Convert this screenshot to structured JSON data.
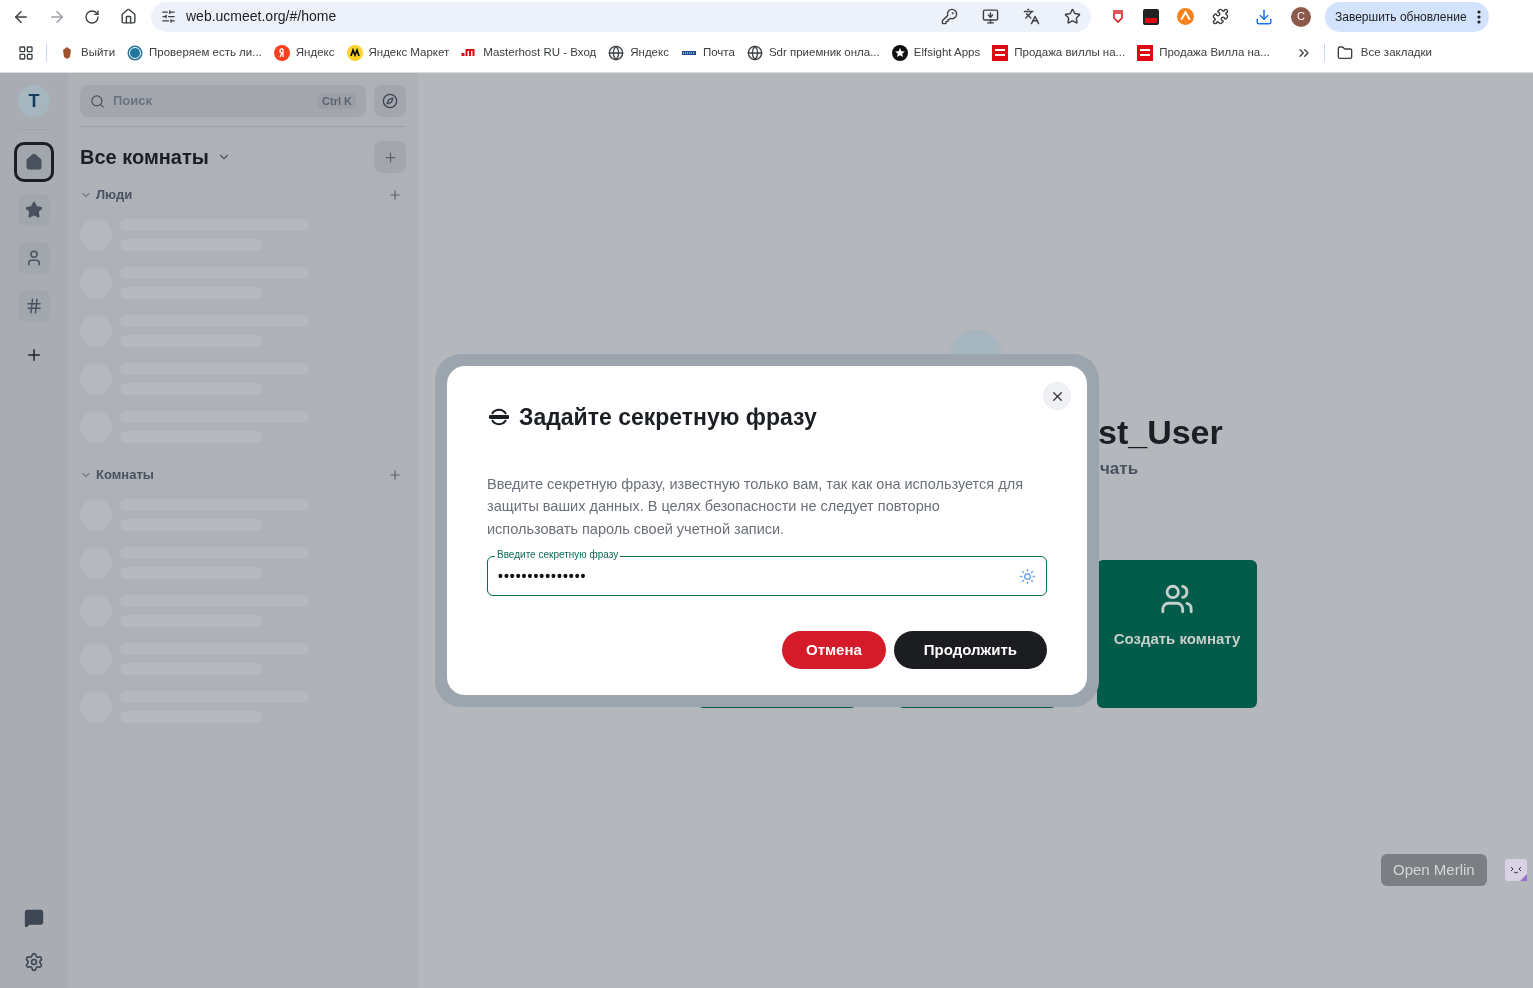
{
  "browser": {
    "url": "web.ucmeet.org/#/home",
    "update_button": "Завершить обновление",
    "profile_initial": "C",
    "bookmarks": [
      {
        "kind": "emblem",
        "label": "Выйти"
      },
      {
        "kind": "wordpress",
        "label": "Проверяем есть ли..."
      },
      {
        "kind": "yandex",
        "label": "Яндекс"
      },
      {
        "kind": "market",
        "label": "Яндекс Маркет"
      },
      {
        "kind": "masterhost",
        "label": "Masterhost RU - Вход"
      },
      {
        "kind": "globe",
        "label": "Яндекс"
      },
      {
        "kind": "mail",
        "label": "Почта"
      },
      {
        "kind": "globe",
        "label": "Sdr приемник онла..."
      },
      {
        "kind": "star",
        "label": "Elfsight Apps"
      },
      {
        "kind": "news",
        "label": "Продажа виллы на..."
      },
      {
        "kind": "news",
        "label": "Продажа Вилла на..."
      }
    ],
    "all_bookmarks": "Все закладки"
  },
  "rail": {
    "avatar": "T",
    "items": [
      {
        "kind": "home",
        "selected": true
      },
      {
        "kind": "star",
        "selected": false
      },
      {
        "kind": "person",
        "selected": false
      },
      {
        "kind": "hash",
        "selected": false
      }
    ]
  },
  "sidebar": {
    "search_placeholder": "Поиск",
    "shortcut": "Ctrl K",
    "title": "Все комнаты",
    "sections": [
      {
        "label": "Люди",
        "expanded": true
      },
      {
        "label": "Комнаты",
        "expanded": true
      }
    ]
  },
  "main": {
    "name": "st_User",
    "subtitle": "чать",
    "card": "Создать комнату"
  },
  "dialog": {
    "title": "Задайте секретную фразу",
    "body": "Введите секретную фразу, известную только вам, так как она используется для защиты ваших данных. В целях безопасности не следует повторно использовать пароль своей учетной записи.",
    "field_label": "Введите секретную фразу",
    "field_value": "•••••••••••••••",
    "cancel": "Отмена",
    "continue": "Продолжить"
  },
  "merlin": "Open Merlin"
}
